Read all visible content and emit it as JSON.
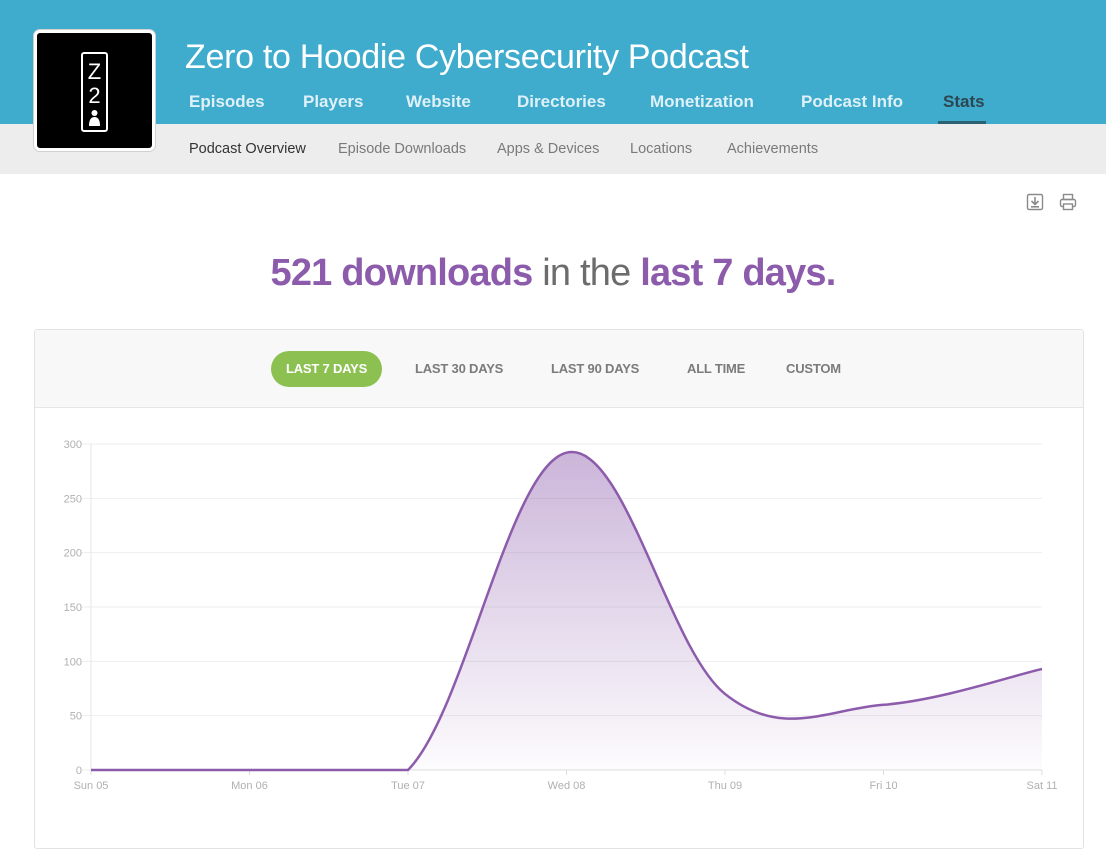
{
  "header": {
    "title": "Zero to Hoodie Cybersecurity Podcast",
    "logo_text": "Z2",
    "bg_color": "#3fabcd"
  },
  "main_nav": [
    {
      "label": "Episodes"
    },
    {
      "label": "Players"
    },
    {
      "label": "Website"
    },
    {
      "label": "Directories"
    },
    {
      "label": "Monetization"
    },
    {
      "label": "Podcast Info"
    },
    {
      "label": "Stats",
      "active": true
    }
  ],
  "sub_nav": [
    {
      "label": "Podcast Overview",
      "active": true
    },
    {
      "label": "Episode Downloads"
    },
    {
      "label": "Apps & Devices"
    },
    {
      "label": "Locations"
    },
    {
      "label": "Achievements"
    }
  ],
  "tools": {
    "download_icon": "download-icon",
    "print_icon": "print-icon"
  },
  "headline": {
    "count": "521 downloads",
    "middle": "in the",
    "period": "last 7 days."
  },
  "range_buttons": [
    {
      "label": "LAST 7 DAYS",
      "active": true
    },
    {
      "label": "LAST 30 DAYS"
    },
    {
      "label": "LAST 90 DAYS"
    },
    {
      "label": "ALL TIME"
    },
    {
      "label": "CUSTOM"
    }
  ],
  "colors": {
    "accent": "#8c5bab",
    "active_button": "#8cc152",
    "line": "#8c5bab"
  },
  "chart_data": {
    "type": "area",
    "categories": [
      "Sun 05",
      "Mon 06",
      "Tue 07",
      "Wed 08",
      "Thu 09",
      "Fri 10",
      "Sat 11"
    ],
    "x": [
      "Sun 05",
      "Mon 06",
      "Tue 07",
      "Wed 08",
      "Thu 09",
      "Fri 10",
      "Sat 11"
    ],
    "values": [
      0,
      0,
      0,
      292,
      70,
      60,
      93
    ],
    "yticks": [
      0,
      50,
      100,
      150,
      200,
      250,
      300
    ],
    "ylim": [
      0,
      300
    ],
    "grid": true,
    "title": "",
    "xlabel": "",
    "ylabel": ""
  }
}
